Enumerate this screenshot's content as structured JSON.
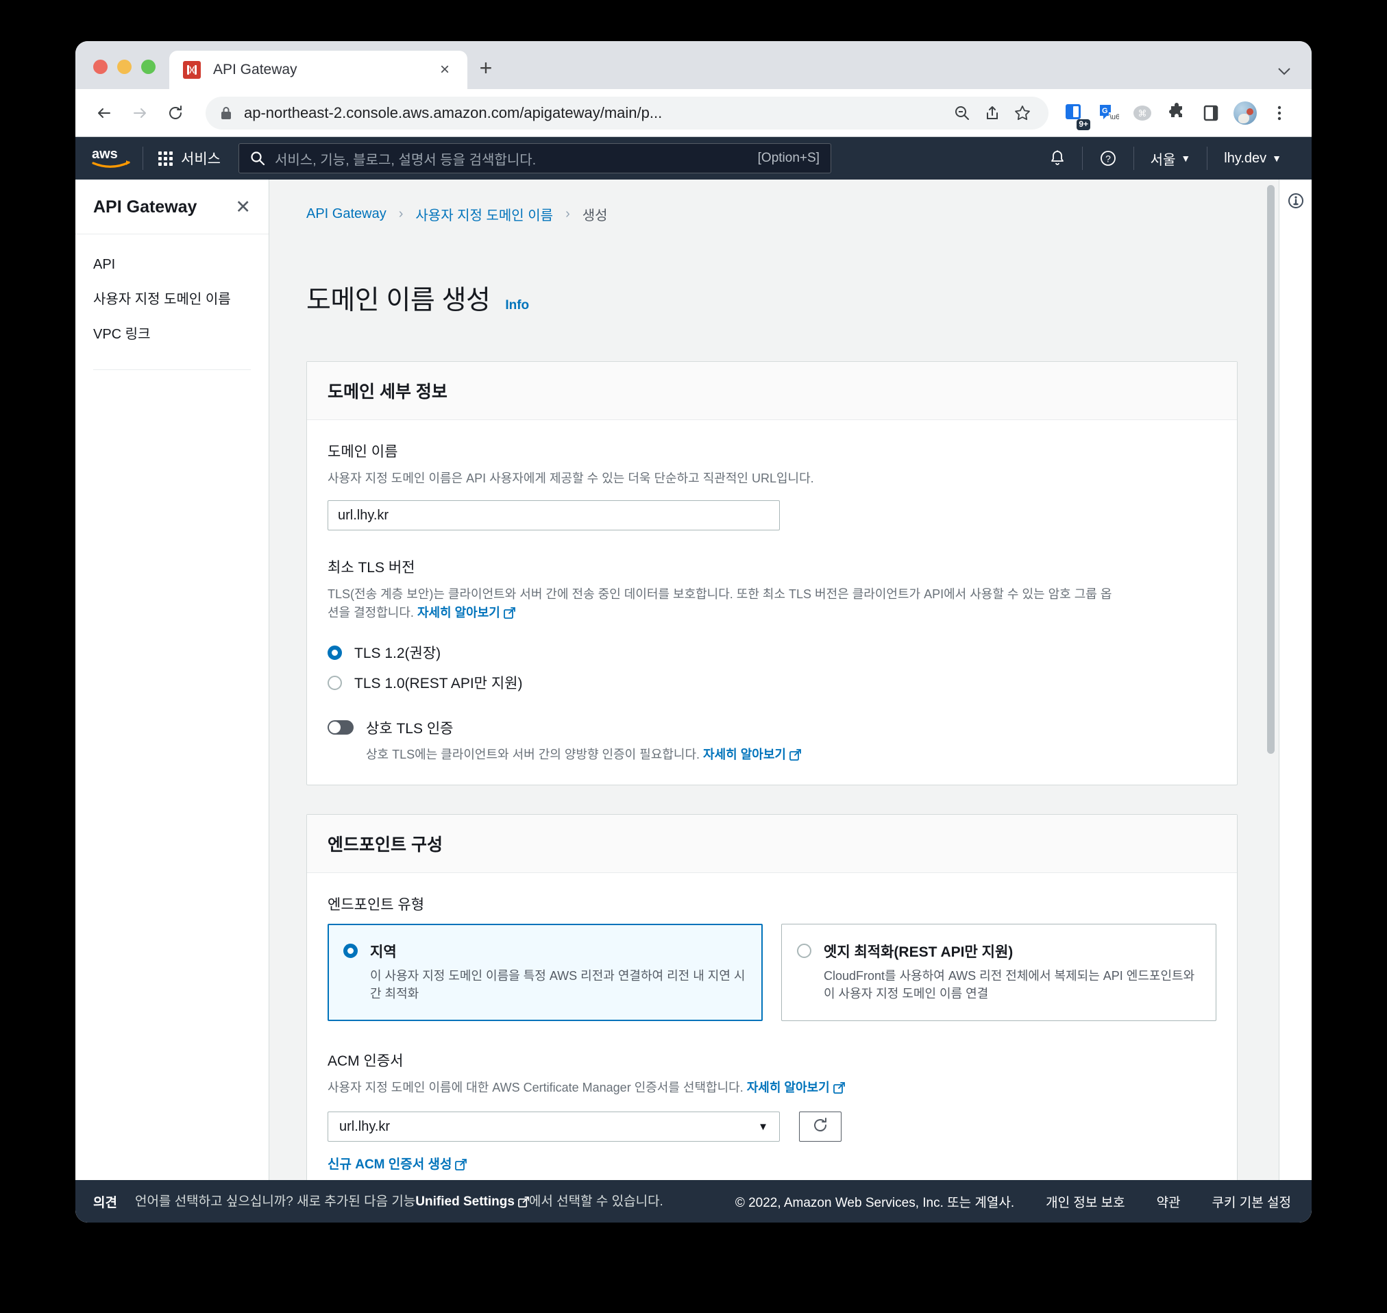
{
  "browser": {
    "tab": {
      "title": "API Gateway",
      "favicon_name": "api-gateway-favicon",
      "close_label": "×"
    },
    "new_tab_label": "+",
    "tabstrip_chevron": "⌄",
    "address": {
      "url_visible": "ap-northeast-2.console.aws.amazon.com/apigateway/main/p...",
      "url_host": "ap-northeast-2.console.aws.amazon.com",
      "url_path": "/apigateway/main/p...",
      "lock_icon": "lock-icon"
    },
    "toolbar_icons": [
      "zoom-out-icon",
      "share-icon",
      "bookmark-star-icon",
      "reading-list-icon",
      "google-translate-icon",
      "command-extension-icon",
      "puzzle-extensions-icon",
      "side-panel-icon",
      "profile-avatar",
      "chrome-menu-icon"
    ],
    "reading_list_badge": "9+"
  },
  "topnav": {
    "logo": "aws-logo",
    "services_label": "서비스",
    "search_placeholder": "서비스, 기능, 블로그, 설명서 등을 검색합니다.",
    "search_shortcut": "[Option+S]",
    "bell_icon": "notifications-bell-icon",
    "help_icon": "help-question-icon",
    "region": "서울",
    "account": "lhy.dev",
    "caret": "▼"
  },
  "sidebar": {
    "title": "API Gateway",
    "close_label": "✕",
    "items": [
      {
        "label": "API"
      },
      {
        "label": "사용자 지정 도메인 이름"
      },
      {
        "label": "VPC 링크"
      }
    ]
  },
  "breadcrumb": {
    "items": [
      {
        "label": "API Gateway",
        "current": false
      },
      {
        "label": "사용자 지정 도메인 이름",
        "current": false
      },
      {
        "label": "생성",
        "current": true
      }
    ],
    "separator": "›"
  },
  "page": {
    "title": "도메인 이름 생성",
    "info_link": "Info"
  },
  "domain_panel": {
    "header": "도메인 세부 정보",
    "domain_name": {
      "label": "도메인 이름",
      "description": "사용자 지정 도메인 이름은 API 사용자에게 제공할 수 있는 더욱 단순하고 직관적인 URL입니다.",
      "value": "url.lhy.kr",
      "placeholder": ""
    },
    "tls": {
      "label": "최소 TLS 버전",
      "description": "TLS(전송 계층 보안)는 클라이언트와 서버 간에 전송 중인 데이터를 보호합니다. 또한 최소 TLS 버전은 클라이언트가 API에서 사용할 수 있는 암호 그룹 옵션을 결정합니다.",
      "learn_more": "자세히 알아보기",
      "options": [
        {
          "label": "TLS 1.2(권장)",
          "selected": true
        },
        {
          "label": "TLS 1.0(REST API만 지원)",
          "selected": false
        }
      ]
    },
    "mutual_tls": {
      "label": "상호 TLS 인증",
      "enabled": false,
      "description": "상호 TLS에는 클라이언트와 서버 간의 양방향 인증이 필요합니다.",
      "learn_more": "자세히 알아보기"
    }
  },
  "endpoint_panel": {
    "header": "엔드포인트 구성",
    "endpoint_type": {
      "label": "엔드포인트 유형",
      "options": [
        {
          "title": "지역",
          "description": "이 사용자 지정 도메인 이름을 특정 AWS 리전과 연결하여 리전 내 지연 시간 최적화",
          "selected": true
        },
        {
          "title": "엣지 최적화(REST API만 지원)",
          "description": "CloudFront를 사용하여 AWS 리전 전체에서 복제되는 API 엔드포인트와 이 사용자 지정 도메인 이름 연결",
          "selected": false
        }
      ]
    },
    "acm": {
      "label": "ACM 인증서",
      "description": "사용자 지정 도메인 이름에 대한 AWS Certificate Manager 인증서를 선택합니다.",
      "learn_more": "자세히 알아보기",
      "selected_value": "url.lhy.kr",
      "caret": "▼",
      "refresh_icon": "refresh-icon",
      "create_link": "신규 ACM 인증서 생성"
    }
  },
  "right_rail": {
    "info_icon": "info-circle-icon"
  },
  "footer": {
    "feedback": "의견",
    "lang_prefix": "언어를 선택하고 싶으십니까? 새로 추가된 다음 기능",
    "lang_link": "Unified Settings",
    "lang_suffix": "에서 선택할 수 있습니다.",
    "copyright": "© 2022, Amazon Web Services, Inc. 또는 계열사.",
    "links": [
      {
        "label": "개인 정보 보호"
      },
      {
        "label": "약관"
      },
      {
        "label": "쿠키 기본 설정"
      }
    ]
  },
  "colors": {
    "aws_navy": "#232f3e",
    "aws_orange": "#ff9900",
    "link_blue": "#0073bb",
    "selected_tile_bg": "#f1faff",
    "page_bg": "#f2f3f3"
  }
}
